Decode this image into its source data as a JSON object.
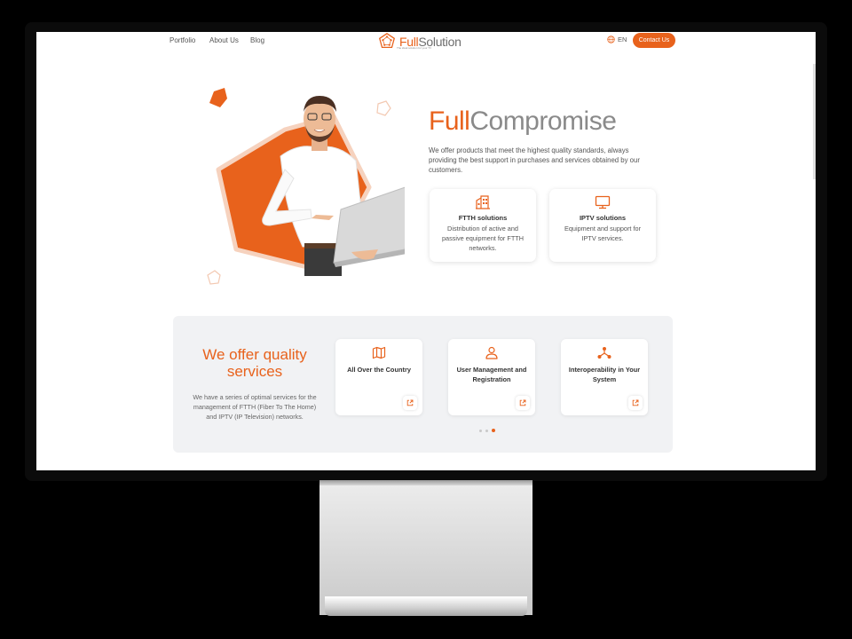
{
  "nav": {
    "links": [
      "Portfolio",
      "About Us",
      "Blog"
    ],
    "logo": {
      "word1": "Full",
      "word2": "Solution",
      "tagline": "The ideal solution for your TV"
    },
    "language": "EN",
    "contact_label": "Contact Us"
  },
  "hero": {
    "title_part1": "Full",
    "title_part2": "Compromise",
    "description": "We offer products that meet the highest quality standards, always providing the best support in purchases and services obtained by our customers.",
    "cards": [
      {
        "icon": "building-icon",
        "title": "FTTH solutions",
        "text": "Distribution of active and passive equipment for FTTH networks."
      },
      {
        "icon": "monitor-icon",
        "title": "IPTV solutions",
        "text": "Equipment and support for IPTV services."
      }
    ]
  },
  "services": {
    "title": "We offer quality services",
    "description": "We have a series of optimal services for the management of FTTH (Fiber To The Home) and IPTV (IP Television) networks.",
    "items": [
      {
        "icon": "map-icon",
        "label": "All Over the Country"
      },
      {
        "icon": "user-icon",
        "label": "User Management and Registration"
      },
      {
        "icon": "network-icon",
        "label": "Interoperability in Your System"
      }
    ],
    "carousel": {
      "count": 3,
      "active": 3
    }
  },
  "colors": {
    "accent": "#e8621c",
    "text_gray": "#8a8a8a",
    "panel_bg": "#f1f2f4"
  }
}
